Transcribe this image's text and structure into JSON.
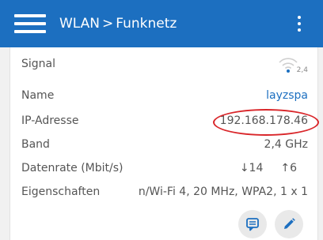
{
  "header": {
    "section": "WLAN",
    "separator": ">",
    "page": "Funknetz"
  },
  "details": {
    "signal_label": "Signal",
    "signal_band": "2,4",
    "name_label": "Name",
    "name_value": "layzspa",
    "ip_label": "IP-Adresse",
    "ip_value": "192.168.178.46",
    "band_label": "Band",
    "band_value": "2,4 GHz",
    "rate_label": "Datenrate (Mbit/s)",
    "rate_down": "↓14",
    "rate_up": "↑6",
    "props_label": "Eigenschaften",
    "props_value": "n/Wi-Fi 4, 20 MHz, WPA2, 1 x 1"
  },
  "icons": {
    "menu": "hamburger-menu-icon",
    "more": "more-vertical-icon",
    "signal": "wifi-signal-icon",
    "comment": "comment-icon",
    "edit": "pencil-edit-icon"
  },
  "colors": {
    "appbar": "#1c6fc0",
    "link": "#1c6fc0",
    "highlight": "#d9262a"
  }
}
